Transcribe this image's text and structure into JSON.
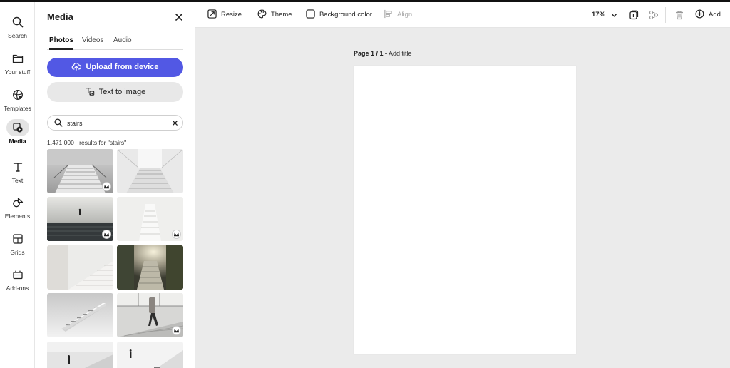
{
  "rail": {
    "items": [
      {
        "label": "Search",
        "icon": "search-icon"
      },
      {
        "label": "Your stuff",
        "icon": "folder-icon"
      },
      {
        "label": "Templates",
        "icon": "templates-icon"
      },
      {
        "label": "Media",
        "icon": "media-icon",
        "active": true
      },
      {
        "label": "Text",
        "icon": "text-icon"
      },
      {
        "label": "Elements",
        "icon": "elements-icon"
      },
      {
        "label": "Grids",
        "icon": "grids-icon"
      },
      {
        "label": "Add-ons",
        "icon": "addons-icon"
      }
    ]
  },
  "panel": {
    "title": "Media",
    "tabs": [
      {
        "label": "Photos",
        "active": true
      },
      {
        "label": "Videos"
      },
      {
        "label": "Audio"
      }
    ],
    "upload_label": "Upload from device",
    "text_to_image_label": "Text to image",
    "search": {
      "value": "stairs",
      "placeholder": "Search"
    },
    "results_text": "1,471,000+ results for \"stairs\"",
    "accent": "#5258e4"
  },
  "toolbar": {
    "resize": "Resize",
    "theme": "Theme",
    "background_color": "Background color",
    "align": "Align",
    "zoom": "17%",
    "add": "Add"
  },
  "canvas": {
    "page_label": "Page 1 / 1 -",
    "add_title": "Add title"
  }
}
